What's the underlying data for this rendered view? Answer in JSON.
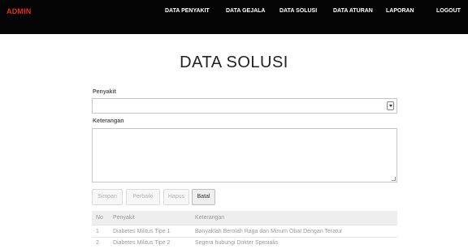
{
  "navbar": {
    "brand": "ADMIN",
    "items": [
      {
        "label": "DATA PENYAKIT"
      },
      {
        "label": "DATA GEJALA"
      },
      {
        "label": "DATA SOLUSI"
      },
      {
        "label": "DATA ATURAN"
      },
      {
        "label": "LAPORAN"
      },
      {
        "label": "LOGOUT"
      }
    ]
  },
  "page": {
    "title": "DATA SOLUSI"
  },
  "form": {
    "penyakit_label": "Penyakit",
    "penyakit_value": "",
    "keterangan_label": "Keterangan",
    "keterangan_value": ""
  },
  "buttons": {
    "simpan": "Simpan",
    "perbaiki": "Perbaiki",
    "hapus": "Hapus",
    "batal": "Batal"
  },
  "table": {
    "headers": [
      "No",
      "Penyakit",
      "Keterangan"
    ],
    "rows": [
      {
        "no": "1",
        "penyakit": "Diabetes Militus Tipe 1",
        "keterangan": "Banyaklah Berolah Raga dan Minum Obat Dengan Teratur"
      },
      {
        "no": "2",
        "penyakit": "Diabetes Militus Tipe 2",
        "keterangan": "Segera hubungi Dokter Spesialis"
      }
    ]
  },
  "icons": {
    "select_arrow": "chevron-down-icon",
    "resize_grip": "resize-grip-icon"
  }
}
